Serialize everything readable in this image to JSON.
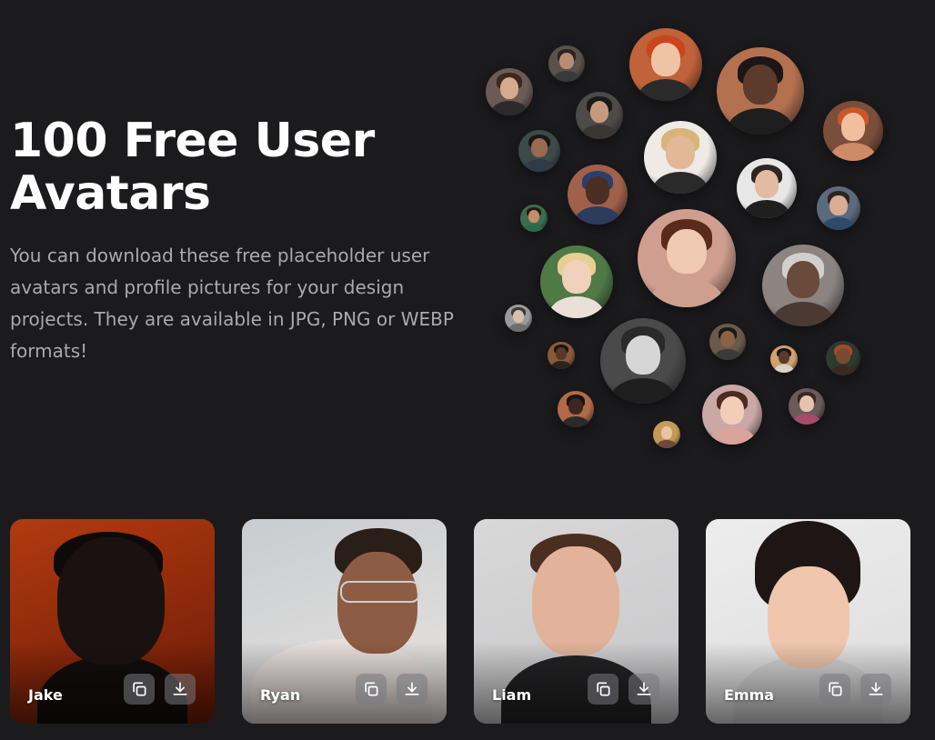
{
  "hero": {
    "title": "100 Free User Avatars",
    "description": "You can download these free placeholder user avatars and profile pictures for your design projects. They are available in JPG, PNG or WEBP formats!"
  },
  "cloud_avatars": [
    {
      "name": "avatar-1",
      "bg": "#6b5a55",
      "skin": "#d7a98d",
      "hair": "#3b2a22",
      "shirt": "#2d2a2c"
    },
    {
      "name": "avatar-2",
      "bg": "#5a514a",
      "skin": "#b88d72",
      "hair": "#2a2320",
      "shirt": "#3a3a3a"
    },
    {
      "name": "avatar-3",
      "bg": "#c0623a",
      "skin": "#efc3a6",
      "hair": "#c8461e",
      "shirt": "#2a2a2a"
    },
    {
      "name": "avatar-4",
      "bg": "#b4714f",
      "skin": "#5c3a2c",
      "hair": "#1c1616",
      "shirt": "#1e1e1e"
    },
    {
      "name": "avatar-5",
      "bg": "#4c4b47",
      "skin": "#c79a80",
      "hair": "#1a1a1a",
      "shirt": "#3a3633"
    },
    {
      "name": "avatar-6",
      "bg": "#3d4a4a",
      "skin": "#9a6a4e",
      "hair": "#1b1716",
      "shirt": "#2f3b46"
    },
    {
      "name": "avatar-7",
      "bg": "#eeeae6",
      "skin": "#e2b896",
      "hair": "#d8b47a",
      "shirt": "#2a2a2a"
    },
    {
      "name": "avatar-8",
      "bg": "#7a4e3a",
      "skin": "#efbfa0",
      "hair": "#c9572b",
      "shirt": "#cf8a66"
    },
    {
      "name": "avatar-9",
      "bg": "#a0604a",
      "skin": "#4a2e22",
      "hair": "#2c3f69",
      "shirt": "#2c3c5e"
    },
    {
      "name": "avatar-10",
      "bg": "#e7e7e7",
      "skin": "#e1bba2",
      "hair": "#2f2521",
      "shirt": "#1f1f1f"
    },
    {
      "name": "avatar-11",
      "bg": "#5c6a7e",
      "skin": "#d8ad93",
      "hair": "#2d2421",
      "shirt": "#2e4a6a"
    },
    {
      "name": "avatar-12",
      "bg": "#3b6e4e",
      "skin": "#c38e6c",
      "hair": "#221a16",
      "shirt": "#2c6b46"
    },
    {
      "name": "avatar-13",
      "bg": "#d09e8e",
      "skin": "#f0cab2",
      "hair": "#5a2a1a",
      "shirt": "#cf9f8e"
    },
    {
      "name": "avatar-14",
      "bg": "#4f7a46",
      "skin": "#f0d1bb",
      "hair": "#e7cf92",
      "shirt": "#e9e0d7"
    },
    {
      "name": "avatar-15",
      "bg": "#8b8481",
      "skin": "#6a4a3a",
      "hair": "#d2d0cf",
      "shirt": "#4a3a33"
    },
    {
      "name": "avatar-16",
      "bg": "#9a9a9a",
      "skin": "#d8c0b0",
      "hair": "#3a3a3a",
      "shirt": "#6e6e6e"
    },
    {
      "name": "avatar-17",
      "bg": "#4a4a4a",
      "skin": "#d6d6d6",
      "hair": "#2a2a2a",
      "shirt": "#1e1e1e"
    },
    {
      "name": "avatar-18",
      "bg": "#8a5a3a",
      "skin": "#5a3726",
      "hair": "#1a1412",
      "shirt": "#2a2420"
    },
    {
      "name": "avatar-19",
      "bg": "#6a5a4a",
      "skin": "#8a6248",
      "hair": "#1e1814",
      "shirt": "#3a3a3a"
    },
    {
      "name": "avatar-20",
      "bg": "#d4a070",
      "skin": "#5a3a2a",
      "hair": "#1a1513",
      "shirt": "#d9d3ce"
    },
    {
      "name": "avatar-21",
      "bg": "#2d3a2c",
      "skin": "#7a4a30",
      "hair": "#a24a2a",
      "shirt": "#3a2a22"
    },
    {
      "name": "avatar-22",
      "bg": "#b06a4a",
      "skin": "#3e2720",
      "hair": "#1a1412",
      "shirt": "#2a2a2a"
    },
    {
      "name": "avatar-23",
      "bg": "#c9a8a6",
      "skin": "#f2cdb9",
      "hair": "#4e2a20",
      "shirt": "#d8a49c"
    },
    {
      "name": "avatar-24",
      "bg": "#6a5a5a",
      "skin": "#e7c2ae",
      "hair": "#3a2622",
      "shirt": "#a84a6a"
    },
    {
      "name": "avatar-25",
      "bg": "#c29a56",
      "skin": "#eac3a2",
      "hair": "#c79a5a",
      "shirt": "#6a4a3a"
    }
  ],
  "cards": [
    {
      "name": "Jake",
      "bg": "#b23a10",
      "bg2": "#6a1a06",
      "skin": "#1a1210",
      "hair": "#0d0a09",
      "shirt": "#120d0b",
      "style": "silhouette"
    },
    {
      "name": "Ryan",
      "bg": "#c8ccd0",
      "bg2": "#e8e4e0",
      "skin": "#8d5c44",
      "hair": "#2a1e18",
      "shirt": "#e6dedb",
      "style": "glasses"
    },
    {
      "name": "Liam",
      "bg": "#d9d8d9",
      "bg2": "#c7c6c8",
      "skin": "#e2b39a",
      "hair": "#4a2e22",
      "shirt": "#232325",
      "style": "plain"
    },
    {
      "name": "Emma",
      "bg": "#ededed",
      "bg2": "#dcdcdc",
      "skin": "#efc6ac",
      "hair": "#1e1614",
      "shirt": "#d6d6d6",
      "style": "bun"
    }
  ],
  "actions": {
    "copy_icon": "copy-icon",
    "download_icon": "download-icon"
  }
}
